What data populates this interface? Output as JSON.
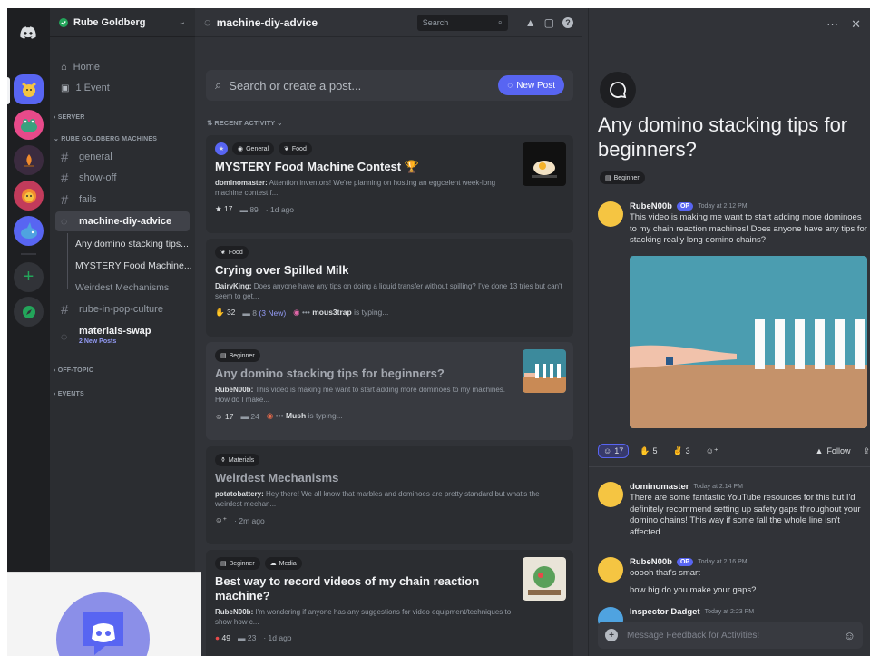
{
  "server": {
    "name": "Rube Goldberg"
  },
  "nav": {
    "home": "Home",
    "event": "1 Event"
  },
  "categories": {
    "server": "SERVER",
    "machines": "RUBE GOLDBERG MACHINES",
    "offtopic": "OFF-TOPIC",
    "events": "EVENTS"
  },
  "channels": {
    "general": "general",
    "showoff": "show-off",
    "fails": "fails",
    "forum": "machine-diy-advice",
    "popculture": "rube-in-pop-culture",
    "swap": "materials-swap",
    "swap_new": "2 New Posts"
  },
  "threads": [
    "Any domino stacking tips...",
    "MYSTERY Food Machine...",
    "Weirdest Mechanisms"
  ],
  "topbar": {
    "title": "machine-diy-advice",
    "search": "Search"
  },
  "postbar": {
    "placeholder": "Search or create a post...",
    "new_post": "New Post"
  },
  "recent": "RECENT ACTIVITY",
  "posts": [
    {
      "tags": [
        "General",
        "Food"
      ],
      "title": "MYSTERY Food Machine Contest 🏆",
      "author": "dominomaster:",
      "body": "Attention inventors! We're planning on hosting an eggcelent week-long machine contest f...",
      "reactions": "17",
      "replies": "89",
      "time": "1d ago"
    },
    {
      "tags": [
        "Food"
      ],
      "title": "Crying over Spilled Milk",
      "author": "DairyKing:",
      "body": "Does anyone have any tips on doing a liquid transfer without spilling? I've done 13 tries but can't seem to get...",
      "reactions": "32",
      "replies": "8",
      "new": "(3 New)",
      "typing_user": "mous3trap",
      "typing": "is typing..."
    },
    {
      "tags": [
        "Beginner"
      ],
      "title": "Any domino stacking tips for beginners?",
      "author": "RubeN00b:",
      "body": "This video is making me want to start adding more dominoes to my machines. How do I make...",
      "reactions": "17",
      "replies": "24",
      "typing_user": "Mush",
      "typing": "is typing..."
    },
    {
      "tags": [
        "Materials"
      ],
      "title": "Weirdest Mechanisms",
      "author": "potatobattery:",
      "body": "Hey there! We all know that marbles and dominoes are pretty standard but what's the weirdest mechan...",
      "time": "2m ago"
    },
    {
      "tags": [
        "Beginner",
        "Media"
      ],
      "title": "Best way to record videos of my chain reaction machine?",
      "author": "RubeN00b:",
      "body": "I'm wondering if anyone has any suggestions for video equipment/techniques to show how c...",
      "reactions": "49",
      "replies": "23",
      "time": "1d ago"
    }
  ],
  "panel": {
    "title": "Any domino stacking tips for beginners?",
    "tag": "Beginner",
    "op": "OP",
    "follow": "Follow",
    "reactions": [
      "17",
      "5",
      "3"
    ],
    "composer": "Message Feedback for Activities!",
    "messages": [
      {
        "user": "RubeN00b",
        "time": "Today at 2:12 PM",
        "text": "This video is making me want to start adding more dominoes to my chain reaction machines! Does anyone have any tips for stacking really long domino chains?"
      },
      {
        "user": "dominomaster",
        "time": "Today at 2:14 PM",
        "text": "There are some fantastic YouTube resources for this but I'd definitely recommend setting up safety gaps throughout your domino chains! This way if some fall the whole line isn't affected."
      },
      {
        "user": "RubeN00b",
        "time": "Today at 2:16 PM",
        "text": "ooooh that's smart",
        "text2": "how big do you make your gaps?"
      },
      {
        "user": "Inspector Dadget",
        "time": "Today at 2:23 PM"
      }
    ]
  },
  "colors": {
    "blurple": "#5865f2",
    "bg": "#313338",
    "sidebar": "#2b2d31",
    "rail": "#1e1f22"
  }
}
